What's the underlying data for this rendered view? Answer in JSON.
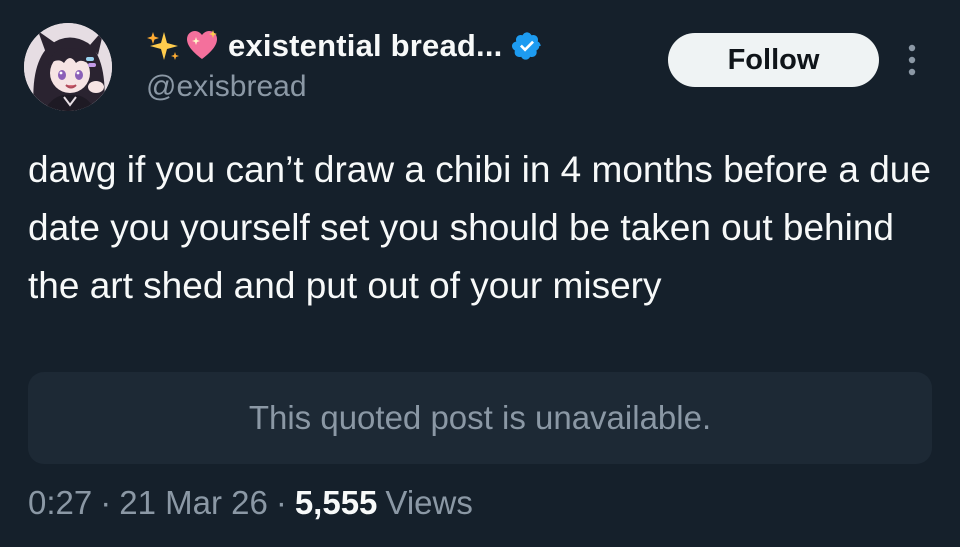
{
  "author": {
    "display_name": "existential bread...",
    "handle": "@exisbread",
    "avatar_icon": "anime-girl-avatar",
    "name_emojis": [
      "sparkles-emoji",
      "sparkling-heart-emoji"
    ],
    "verified_icon": "verified-badge-icon",
    "verified_color": "#1d9bf0"
  },
  "actions": {
    "follow_label": "Follow",
    "more_icon": "more-vertical-icon"
  },
  "tweet": {
    "text": "dawg if you can’t draw a chibi in 4 months before a due date you yourself set you should be taken out behind the art shed and put out of your misery"
  },
  "quote": {
    "text": "This quoted post is unavailable."
  },
  "meta": {
    "time": "0:27",
    "separator": "·",
    "date": "21 Mar 26",
    "views_count": "5,555",
    "views_label": "Views"
  },
  "colors": {
    "background": "#15202b",
    "text_primary": "#f7f9f9",
    "text_secondary": "#8b98a5",
    "quote_background": "#1d2935",
    "follow_button": "#eff3f4"
  }
}
